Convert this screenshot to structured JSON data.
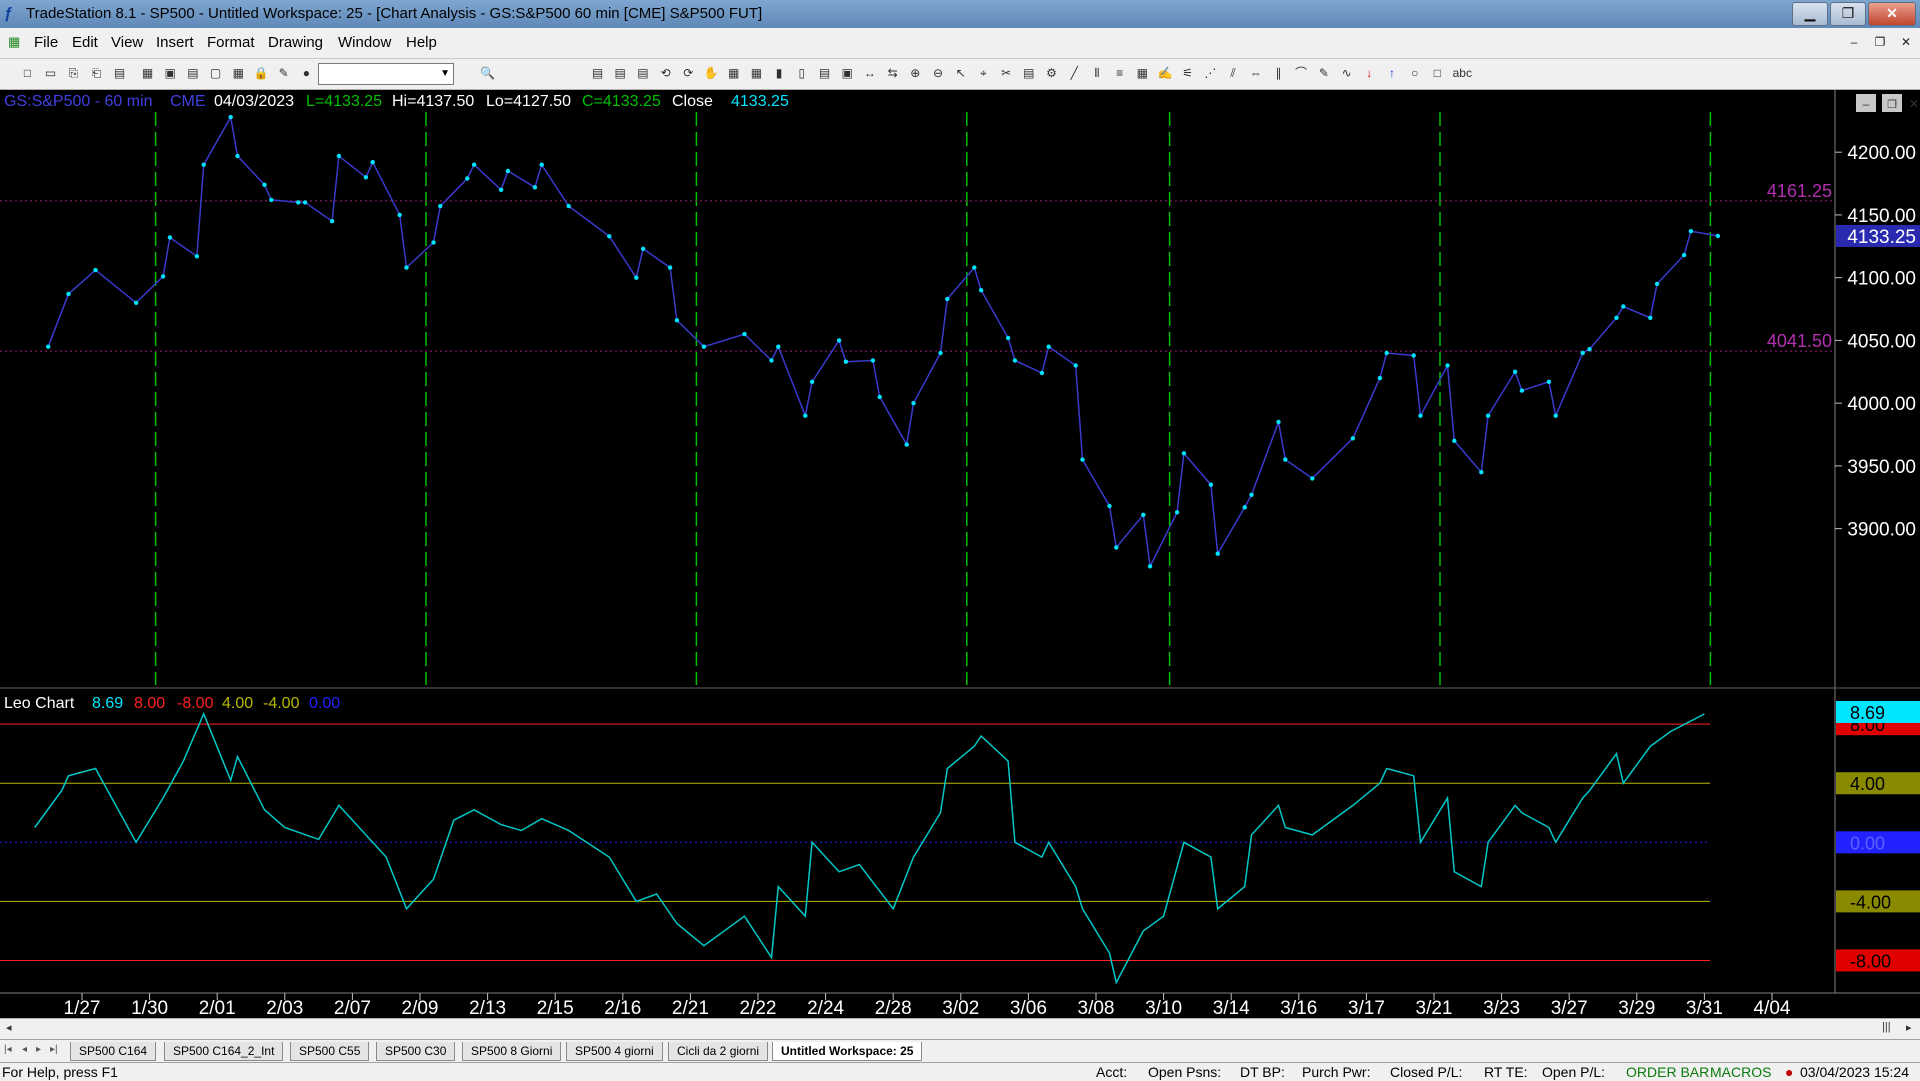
{
  "window": {
    "title": "TradeStation 8.1 - SP500 - Untitled Workspace:  25 - [Chart Analysis - GS:S&P500  60 min  [CME] S&P500 FUT]",
    "minimize": "▁",
    "restore": "❐",
    "close": "✕",
    "app_icon": "tradestation-icon"
  },
  "menu": {
    "items": [
      "File",
      "Edit",
      "View",
      "Insert",
      "Format",
      "Drawing",
      "Window",
      "Help"
    ],
    "mdi": [
      "–",
      "❐",
      "✕"
    ]
  },
  "toolbar": {
    "icons": [
      "new-icon",
      "open-icon",
      "copy-icon",
      "paste-icon",
      "folder-icon",
      "save-icon",
      "print-icon",
      "print-preview-icon",
      "window-icon",
      "chart-icon",
      "lock-icon",
      "draw-icon",
      "globe-icon",
      "zoom-icon",
      "layout-icon",
      "layout-icon",
      "layout-icon",
      "link-icon",
      "refresh-icon",
      "hand-icon",
      "grid-icon",
      "data-icon",
      "bar-chart-icon",
      "candle-icon",
      "format-icon",
      "chart-type-icon",
      "arrow-lr-icon",
      "arrow-lr-icon",
      "zoom-in-icon",
      "zoom-out-icon",
      "pointer-icon",
      "cursor-icon",
      "tools-icon",
      "insert-icon",
      "gear-icon",
      "trendline-icon",
      "grid-lines-icon",
      "list-icon",
      "table-icon",
      "pen-icon",
      "fib-icon",
      "lines-icon",
      "channel-icon",
      "arrows-icon",
      "parallel-icon",
      "arc-icon",
      "pencil-icon",
      "curve-icon",
      "down-arrow-icon",
      "up-arrow-icon",
      "circle-icon",
      "rectangle-icon",
      "text-icon"
    ],
    "icon_glyphs": [
      "□",
      "▭",
      "⎘",
      "⎗",
      "▤",
      "▦",
      "▣",
      "▤",
      "▢",
      "▦",
      "🔒",
      "✎",
      "●",
      "🔍",
      "▤",
      "▤",
      "▤",
      "⟲",
      "⟳",
      "✋",
      "▦",
      "▦",
      "▮",
      "▯",
      "▤",
      "▣",
      "↔",
      "⇆",
      "⊕",
      "⊖",
      "↖",
      "⌖",
      "✂",
      "▤",
      "⚙",
      "╱",
      "⦀",
      "≡",
      "▦",
      "✍",
      "⚟",
      "⋰",
      "⫽",
      "⇔",
      "∥",
      "⌒",
      "✎",
      "∿",
      "↓",
      "↑",
      "○",
      "□",
      "abc"
    ],
    "text_button": "abc"
  },
  "chart_data": [
    {
      "type": "line",
      "symbol": "GS:S&P500 - 60 min",
      "exchange": "CME",
      "header": {
        "date": "04/03/2023",
        "last": "L=4133.25",
        "high": "Hi=4137.50",
        "low": "Lo=4127.50",
        "close_value": "C=4133.25",
        "close_label": "Close",
        "close_readout": "4133.25"
      },
      "ylim": [
        3875,
        4240
      ],
      "yticks": [
        "4200.00",
        "4150.00",
        "4100.00",
        "4050.00",
        "4000.00",
        "3950.00",
        "3900.00"
      ],
      "ytick_values": [
        4200,
        4150,
        4100,
        4050,
        4000,
        3950,
        3900
      ],
      "reference_lines": [
        {
          "value": 4161.25,
          "label": "4161.25"
        },
        {
          "value": 4041.5,
          "label": "4041.50"
        }
      ],
      "last_value_label": "4133.25",
      "xlabels": [
        "1/27",
        "1/30",
        "2/01",
        "2/03",
        "2/07",
        "2/09",
        "2/13",
        "2/15",
        "2/16",
        "2/21",
        "2/22",
        "2/24",
        "2/28",
        "3/02",
        "3/06",
        "3/08",
        "3/10",
        "3/14",
        "3/16",
        "3/17",
        "3/21",
        "3/23",
        "3/27",
        "3/29",
        "3/31",
        "4/04"
      ],
      "cycle_markers": [
        "1/30",
        "2/09",
        "2/21",
        "3/02",
        "3/10",
        "3/21",
        "3/31"
      ],
      "series": [
        {
          "colors": {
            "line": "#3a3acc",
            "points": "#00e5ff"
          },
          "points": [
            [
              "1/26",
              4045
            ],
            [
              "1/27",
              4087
            ],
            [
              "1/27",
              4106
            ],
            [
              "1/30",
              4080
            ],
            [
              "1/30",
              4101
            ],
            [
              "1/31",
              4132
            ],
            [
              "1/31",
              4117
            ],
            [
              "2/01",
              4190
            ],
            [
              "2/01",
              4228
            ],
            [
              "2/02",
              4197
            ],
            [
              "2/02",
              4174
            ],
            [
              "2/03",
              4162
            ],
            [
              "2/03",
              4160
            ],
            [
              "2/06",
              4160
            ],
            [
              "2/06",
              4145
            ],
            [
              "2/07",
              4197
            ],
            [
              "2/07",
              4180
            ],
            [
              "2/08",
              4192
            ],
            [
              "2/08",
              4150
            ],
            [
              "2/09",
              4108
            ],
            [
              "2/09",
              4128
            ],
            [
              "2/10",
              4157
            ],
            [
              "2/10",
              4179
            ],
            [
              "2/13",
              4190
            ],
            [
              "2/13",
              4170
            ],
            [
              "2/14",
              4185
            ],
            [
              "2/14",
              4172
            ],
            [
              "2/15",
              4190
            ],
            [
              "2/15",
              4157
            ],
            [
              "2/16",
              4133
            ],
            [
              "2/16",
              4100
            ],
            [
              "2/17",
              4123
            ],
            [
              "2/17",
              4108
            ],
            [
              "2/21",
              4066
            ],
            [
              "2/21",
              4045
            ],
            [
              "2/22",
              4055
            ],
            [
              "2/22",
              4034
            ],
            [
              "2/23",
              4045
            ],
            [
              "2/23",
              3990
            ],
            [
              "2/24",
              4017
            ],
            [
              "2/24",
              4050
            ],
            [
              "2/27",
              4033
            ],
            [
              "2/27",
              4034
            ],
            [
              "2/28",
              4005
            ],
            [
              "2/28",
              3967
            ],
            [
              "3/01",
              4000
            ],
            [
              "3/01",
              4040
            ],
            [
              "3/02",
              4083
            ],
            [
              "3/02",
              4108
            ],
            [
              "3/03",
              4090
            ],
            [
              "3/03",
              4052
            ],
            [
              "3/06",
              4034
            ],
            [
              "3/06",
              4024
            ],
            [
              "3/07",
              4045
            ],
            [
              "3/07",
              4030
            ],
            [
              "3/08",
              3955
            ],
            [
              "3/08",
              3918
            ],
            [
              "3/09",
              3885
            ],
            [
              "3/09",
              3911
            ],
            [
              "3/10",
              3870
            ],
            [
              "3/10",
              3913
            ],
            [
              "3/13",
              3960
            ],
            [
              "3/13",
              3935
            ],
            [
              "3/14",
              3880
            ],
            [
              "3/14",
              3917
            ],
            [
              "3/15",
              3927
            ],
            [
              "3/15",
              3985
            ],
            [
              "3/16",
              3955
            ],
            [
              "3/16",
              3940
            ],
            [
              "3/17",
              3972
            ],
            [
              "3/17",
              4020
            ],
            [
              "3/20",
              4040
            ],
            [
              "3/20",
              4038
            ],
            [
              "3/21",
              3990
            ],
            [
              "3/21",
              4030
            ],
            [
              "3/22",
              3970
            ],
            [
              "3/22",
              3945
            ],
            [
              "3/23",
              3990
            ],
            [
              "3/23",
              4025
            ],
            [
              "3/24",
              4010
            ],
            [
              "3/24",
              4017
            ],
            [
              "3/27",
              3990
            ],
            [
              "3/27",
              4040
            ],
            [
              "3/28",
              4043
            ],
            [
              "3/28",
              4068
            ],
            [
              "3/29",
              4077
            ],
            [
              "3/29",
              4068
            ],
            [
              "3/30",
              4095
            ],
            [
              "3/30",
              4118
            ],
            [
              "3/31",
              4137
            ],
            [
              "3/31",
              4133.25
            ]
          ]
        }
      ]
    },
    {
      "type": "line",
      "title": "Leo Chart",
      "values_readout": {
        "value": "8.69",
        "upper2": "8.00",
        "lower2": "-8.00",
        "upper1": "4.00",
        "lower1": "-4.00",
        "zero": "0.00"
      },
      "ylim": [
        -10,
        9.5
      ],
      "levels": [
        {
          "value": 8,
          "label": "8.00",
          "color": "#ff2020"
        },
        {
          "value": 4,
          "label": "4.00",
          "color": "#b8b800"
        },
        {
          "value": 0,
          "label": "0.00",
          "color": "#2222ff"
        },
        {
          "value": -4,
          "label": "-4.00",
          "color": "#b8b800"
        },
        {
          "value": -8,
          "label": "-8.00",
          "color": "#ff2020"
        }
      ],
      "last_value_label": "8.69",
      "series": [
        {
          "colors": {
            "line": "#00c8c8"
          },
          "points": [
            [
              "1/26",
              1
            ],
            [
              "1/26",
              3.5
            ],
            [
              "1/27",
              4.5
            ],
            [
              "1/27",
              5
            ],
            [
              "1/30",
              0
            ],
            [
              "1/30",
              3
            ],
            [
              "1/31",
              5.5
            ],
            [
              "2/01",
              8.7
            ],
            [
              "2/01",
              4.2
            ],
            [
              "2/02",
              5.8
            ],
            [
              "2/02",
              2.2
            ],
            [
              "2/03",
              1
            ],
            [
              "2/06",
              0.2
            ],
            [
              "2/07",
              2.5
            ],
            [
              "2/07",
              0.5
            ],
            [
              "2/08",
              -1
            ],
            [
              "2/09",
              -4.5
            ],
            [
              "2/09",
              -2.5
            ],
            [
              "2/10",
              1.5
            ],
            [
              "2/13",
              2.2
            ],
            [
              "2/13",
              1.2
            ],
            [
              "2/14",
              0.8
            ],
            [
              "2/15",
              1.6
            ],
            [
              "2/15",
              0.8
            ],
            [
              "2/16",
              -1
            ],
            [
              "2/16",
              -4
            ],
            [
              "2/17",
              -3.5
            ],
            [
              "2/21",
              -5.5
            ],
            [
              "2/21",
              -7
            ],
            [
              "2/22",
              -5
            ],
            [
              "2/22",
              -7.8
            ],
            [
              "2/23",
              -3
            ],
            [
              "2/23",
              -5
            ],
            [
              "2/24",
              0
            ],
            [
              "2/24",
              -2
            ],
            [
              "2/27",
              -1.5
            ],
            [
              "2/28",
              -4.5
            ],
            [
              "3/01",
              -1
            ],
            [
              "3/01",
              2
            ],
            [
              "3/02",
              5
            ],
            [
              "3/02",
              6.5
            ],
            [
              "3/03",
              7.2
            ],
            [
              "3/03",
              5.5
            ],
            [
              "3/06",
              0
            ],
            [
              "3/06",
              -1
            ],
            [
              "3/07",
              0
            ],
            [
              "3/07",
              -3
            ],
            [
              "3/08",
              -4.5
            ],
            [
              "3/08",
              -7.5
            ],
            [
              "3/09",
              -9.5
            ],
            [
              "3/09",
              -6
            ],
            [
              "3/10",
              -5
            ],
            [
              "3/13",
              0
            ],
            [
              "3/13",
              -1
            ],
            [
              "3/14",
              -4.5
            ],
            [
              "3/14",
              -3
            ],
            [
              "3/15",
              0.5
            ],
            [
              "3/15",
              2.5
            ],
            [
              "3/16",
              1
            ],
            [
              "3/16",
              0.5
            ],
            [
              "3/17",
              2.5
            ],
            [
              "3/17",
              4
            ],
            [
              "3/20",
              5
            ],
            [
              "3/20",
              4.5
            ],
            [
              "3/21",
              0
            ],
            [
              "3/21",
              3
            ],
            [
              "3/22",
              -2
            ],
            [
              "3/22",
              -3
            ],
            [
              "3/23",
              0
            ],
            [
              "3/23",
              2.5
            ],
            [
              "3/24",
              2
            ],
            [
              "3/24",
              1
            ],
            [
              "3/27",
              0
            ],
            [
              "3/27",
              3
            ],
            [
              "3/28",
              3.5
            ],
            [
              "3/28",
              6
            ],
            [
              "3/29",
              4
            ],
            [
              "3/29",
              6.5
            ],
            [
              "3/30",
              7.5
            ],
            [
              "3/31",
              8.69
            ]
          ]
        }
      ]
    }
  ],
  "scroll": {
    "left": "◂",
    "right": "▸",
    "thumb": "|||"
  },
  "tabs": {
    "nav": [
      "|◂",
      "◂",
      "▸",
      "▸|"
    ],
    "items": [
      "SP500 C164",
      "SP500 C164_2_Int",
      "SP500 C55",
      "SP500 C30",
      "SP500 8 Giorni",
      "SP500 4 giorni",
      "Cicli da 2 giorni",
      "Untitled Workspace:  25"
    ],
    "active": "Untitled Workspace:  25"
  },
  "status": {
    "help": "For Help, press F1",
    "acct": "Acct:",
    "open_psns": "Open Psns:",
    "dt_bp": "DT BP:",
    "purch_pwr": "Purch Pwr:",
    "closed_pl": "Closed P/L:",
    "rt_te": "RT TE:",
    "open_pl": "Open P/L:",
    "order_bar": "ORDER BAR",
    "macros": "MACROS",
    "datetime": "03/04/2023 15:24"
  }
}
